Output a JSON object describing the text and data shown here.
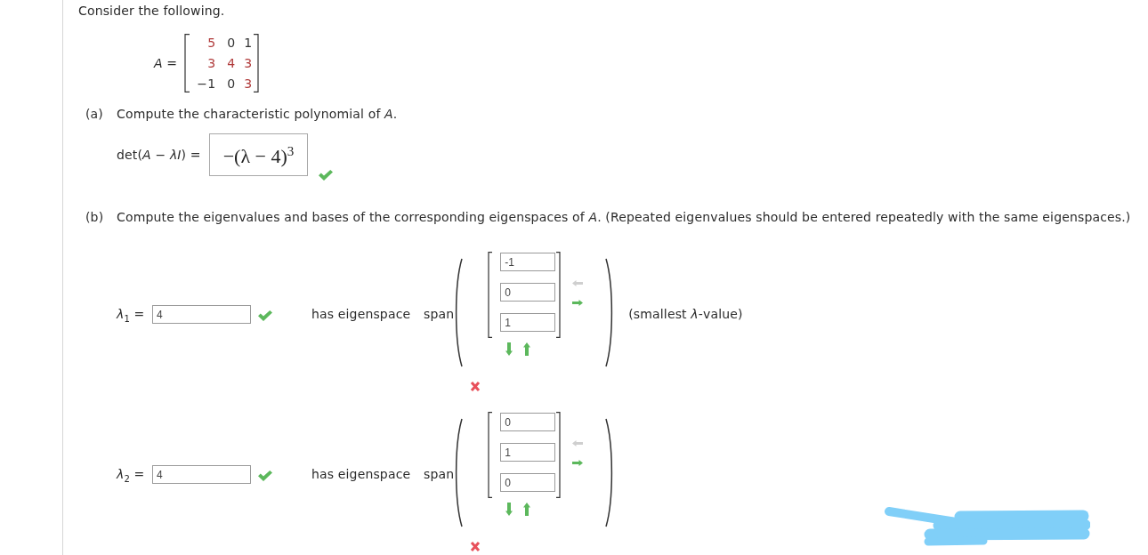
{
  "intro": "Consider the following.",
  "matrix": {
    "label": "*A* =",
    "rows": [
      [
        {
          "value": "5",
          "color": "#b03a3a"
        },
        {
          "value": "0",
          "color": "#333333"
        },
        {
          "value": "1",
          "color": "#333333"
        }
      ],
      [
        {
          "value": "3",
          "color": "#b03a3a"
        },
        {
          "value": "4",
          "color": "#b03a3a"
        },
        {
          "value": "3",
          "color": "#b03a3a"
        }
      ],
      [
        {
          "value": "−1",
          "color": "#333333"
        },
        {
          "value": "0",
          "color": "#333333"
        },
        {
          "value": "3",
          "color": "#b03a3a"
        }
      ]
    ]
  },
  "parts": [
    {
      "kind": "polynomial",
      "marker": "(a)",
      "prompt": "Compute the characteristic polynomial of *A*.",
      "answer_label": "det(*A* − *λI*) =",
      "answer": "−(λ − 4)$^{3}$",
      "correct": true
    },
    {
      "kind": "eigenspaces",
      "marker": "(b)",
      "prompt": "Compute the eigenvalues and bases of the corresponding eigenspaces of *A*. (Repeated eigenvalues should be entered repeatedly with the same eigenspaces.)",
      "eigenvalues": [
        {
          "label": "*λ*$_{1}$ =",
          "value": "4",
          "correct": true,
          "eigenspace_label": "has eigenspace",
          "span_label": "span",
          "vector": [
            "-1",
            "0",
            "1"
          ],
          "arrows": [
            {
              "kind": "remove_column",
              "disabled": true
            },
            {
              "kind": "add_column",
              "disabled": false
            },
            {
              "kind": "add_row",
              "disabled": false
            },
            {
              "kind": "remove_row",
              "disabled": false
            }
          ],
          "basis_correct": false,
          "note": "(smallest *λ*-value)"
        },
        {
          "label": "*λ*$_{2}$ =",
          "value": "4",
          "correct": true,
          "eigenspace_label": "has eigenspace",
          "span_label": "span",
          "vector": [
            "0",
            "1",
            "0"
          ],
          "arrows": [
            {
              "kind": "remove_column",
              "disabled": true
            },
            {
              "kind": "add_column",
              "disabled": false
            },
            {
              "kind": "add_row",
              "disabled": false
            },
            {
              "kind": "remove_row",
              "disabled": false
            }
          ],
          "basis_correct": false
        }
      ]
    }
  ]
}
